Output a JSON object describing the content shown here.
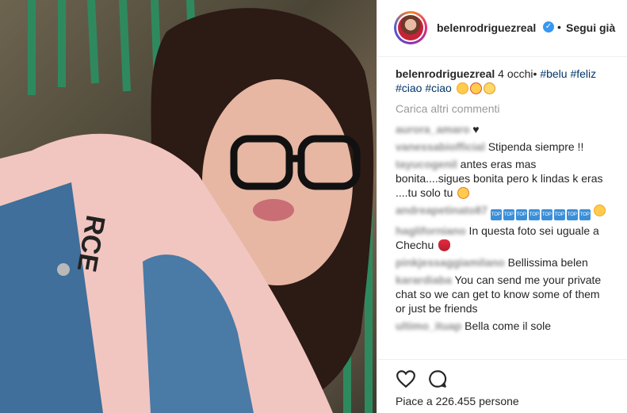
{
  "post": {
    "photo_alt": "selfie-photo"
  },
  "header": {
    "username": "belenrodriguezreal",
    "verified_icon": "verified-badge-icon",
    "separator": "•",
    "follow_label": "Segui già"
  },
  "caption": {
    "username": "belenrodriguezreal",
    "text": " 4 occhi• ",
    "tags": [
      "#belu",
      "#feliz",
      "#ciao",
      "#ciao"
    ]
  },
  "load_more": "Carica altri commenti",
  "comments": [
    {
      "user": "aurora_amaro",
      "text": " ♥"
    },
    {
      "user": "vanessabiofficial",
      "text": " Stipenda siempre !!"
    },
    {
      "user": "tayucogenil",
      "text": " antes eras mas bonita....sigues bonita pero k lindas k eras ....tu solo tu "
    },
    {
      "user": "andreapetinato87",
      "text": " "
    },
    {
      "user": "hagliforniano",
      "text": " In questa foto sei uguale a Chechu "
    },
    {
      "user": "pinkjessaggiamilano",
      "text": " Bellissima belen"
    },
    {
      "user": "karardiaba",
      "text": " You can send me your private chat so we can get to know some of them or just be friends"
    },
    {
      "user": "ultimo_ituap",
      "text": " Bella come il sole"
    }
  ],
  "top_icon_label": "TOP",
  "actions": {
    "like_icon": "heart-outline-icon",
    "comment_icon": "comment-bubble-icon"
  },
  "likes_text": "Piace a 226.455 persone",
  "colors": {
    "link": "#003569",
    "muted": "#999999",
    "verified": "#3897f0",
    "border": "#efefef"
  }
}
